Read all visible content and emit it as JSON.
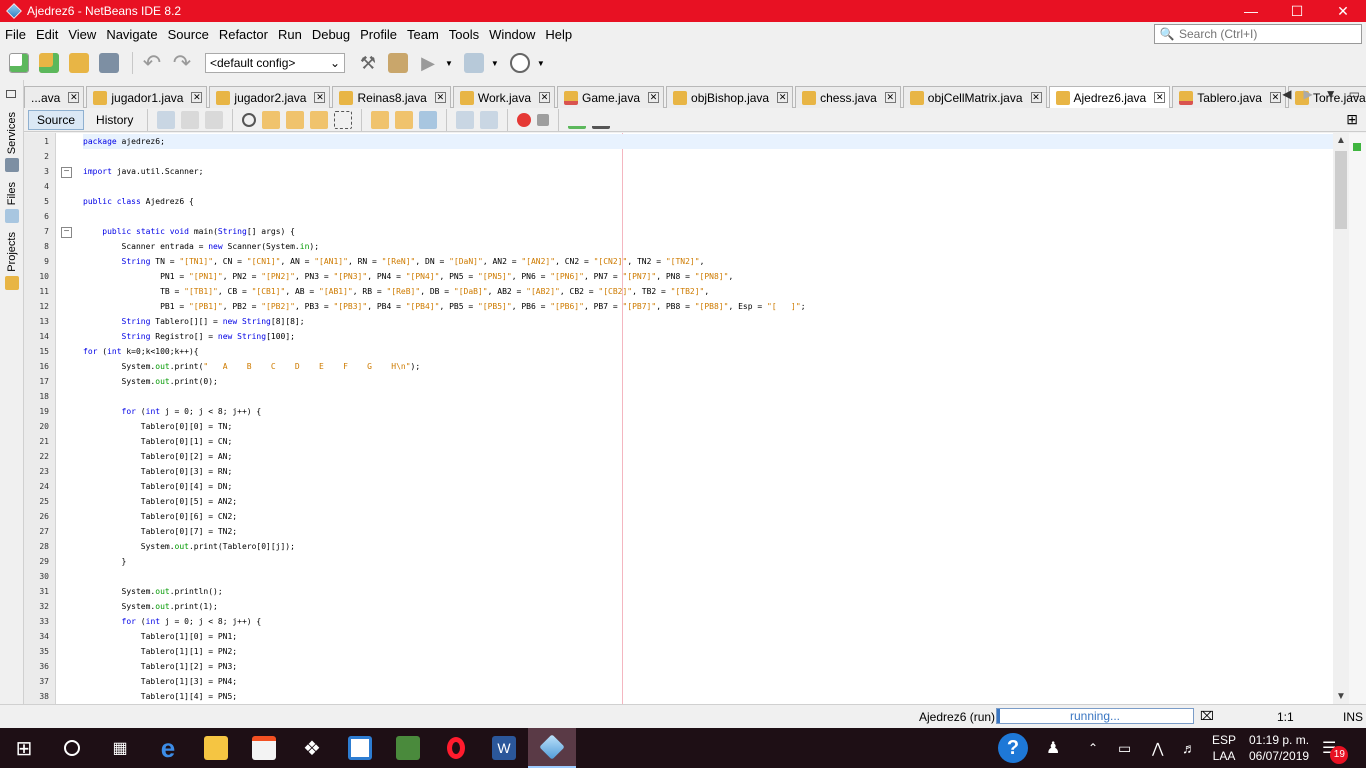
{
  "window": {
    "title": "Ajedrez6 - NetBeans IDE 8.2",
    "minimize_icon": "minimize-icon",
    "maximize_icon": "maximize-icon",
    "close_icon": "close-icon",
    "accent": "#e81123"
  },
  "menu": [
    "File",
    "Edit",
    "View",
    "Navigate",
    "Source",
    "Refactor",
    "Run",
    "Debug",
    "Profile",
    "Team",
    "Tools",
    "Window",
    "Help"
  ],
  "search": {
    "placeholder": "Search (Ctrl+I)"
  },
  "toolbar": {
    "config_value": "<default config>"
  },
  "sidebar": {
    "services": "Services",
    "files": "Files",
    "projects": "Projects"
  },
  "tabs": [
    {
      "label": "...ava"
    },
    {
      "label": "jugador1.java"
    },
    {
      "label": "jugador2.java"
    },
    {
      "label": "Reinas8.java"
    },
    {
      "label": "Work.java"
    },
    {
      "label": "Game.java"
    },
    {
      "label": "objBishop.java"
    },
    {
      "label": "chess.java"
    },
    {
      "label": "objCellMatrix.java"
    },
    {
      "label": "Ajedrez6.java",
      "active": true
    },
    {
      "label": "Tablero.java"
    },
    {
      "label": "Torre.java"
    }
  ],
  "view": {
    "source": "Source",
    "history": "History"
  },
  "code": [
    "package ajedrez6;",
    "",
    "import java.util.Scanner;",
    "",
    "public class Ajedrez6 {",
    "",
    "    public static void main(String[] args) {",
    "        Scanner entrada = new Scanner(System.in);",
    "        String TN = \"[TN1]\", CN = \"[CN1]\", AN = \"[AN1]\", RN = \"[ReN]\", DN = \"[DaN]\", AN2 = \"[AN2]\", CN2 = \"[CN2]\", TN2 = \"[TN2]\",",
    "                PN1 = \"[PN1]\", PN2 = \"[PN2]\", PN3 = \"[PN3]\", PN4 = \"[PN4]\", PN5 = \"[PN5]\", PN6 = \"[PN6]\", PN7 = \"[PN7]\", PN8 = \"[PN8]\",",
    "                TB = \"[TB1]\", CB = \"[CB1]\", AB = \"[AB1]\", RB = \"[ReB]\", DB = \"[DaB]\", AB2 = \"[AB2]\", CB2 = \"[CB2]\", TB2 = \"[TB2]\",",
    "                PB1 = \"[PB1]\", PB2 = \"[PB2]\", PB3 = \"[PB3]\", PB4 = \"[PB4]\", PB5 = \"[PB5]\", PB6 = \"[PB6]\", PB7 = \"[PB7]\", PB8 = \"[PB8]\", Esp = \"[   ]\";",
    "        String Tablero[][] = new String[8][8];",
    "        String Registro[] = new String[100];",
    "for (int k=0;k<100;k++){",
    "        System.out.print(\"   A    B    C    D    E    F    G    H\\n\");",
    "        System.out.print(0);",
    "",
    "        for (int j = 0; j < 8; j++) {",
    "            Tablero[0][0] = TN;",
    "            Tablero[0][1] = CN;",
    "            Tablero[0][2] = AN;",
    "            Tablero[0][3] = RN;",
    "            Tablero[0][4] = DN;",
    "            Tablero[0][5] = AN2;",
    "            Tablero[0][6] = CN2;",
    "            Tablero[0][7] = TN2;",
    "            System.out.print(Tablero[0][j]);",
    "        }",
    "",
    "        System.out.println();",
    "        System.out.print(1);",
    "        for (int j = 0; j < 8; j++) {",
    "            Tablero[1][0] = PN1;",
    "            Tablero[1][1] = PN2;",
    "            Tablero[1][2] = PN3;",
    "            Tablero[1][3] = PN4;",
    "            Tablero[1][4] = PN5;"
  ],
  "status": {
    "project": "Ajedrez6 (run)",
    "progress": "running...",
    "position": "1:1",
    "mode": "INS"
  },
  "taskbar": {
    "lang": "ESP",
    "lang2": "LAA",
    "time": "01:19 p. m.",
    "date": "06/07/2019",
    "notifications": "19"
  }
}
